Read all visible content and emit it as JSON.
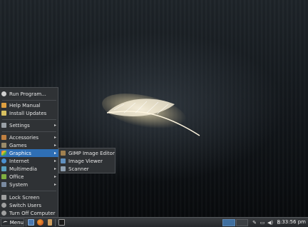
{
  "menu": {
    "items": [
      {
        "name": "run-program",
        "label": "Run Program...",
        "icon": "run-icon",
        "color": "#cfcfcf",
        "arrow": false
      },
      {
        "name": "help-manual",
        "label": "Help Manual",
        "icon": "help-icon",
        "color": "#e0a040",
        "arrow": false
      },
      {
        "name": "install-updates",
        "label": "Install Updates",
        "icon": "update-icon",
        "color": "#d8c060",
        "arrow": false
      },
      {
        "name": "settings",
        "label": "Settings",
        "icon": "settings-icon",
        "color": "#9aa0a6",
        "arrow": true
      },
      {
        "name": "accessories",
        "label": "Accessories",
        "icon": "accessories-icon",
        "color": "#c08040",
        "arrow": true
      },
      {
        "name": "games",
        "label": "Games",
        "icon": "games-icon",
        "color": "#9a8b6a",
        "arrow": true
      },
      {
        "name": "graphics",
        "label": "Graphics",
        "icon": "graphics-icon",
        "color": "#d04080",
        "arrow": true
      },
      {
        "name": "internet",
        "label": "Internet",
        "icon": "internet-icon",
        "color": "#4a90d0",
        "arrow": true
      },
      {
        "name": "multimedia",
        "label": "Multimedia",
        "icon": "multimedia-icon",
        "color": "#5aa0c0",
        "arrow": true
      },
      {
        "name": "office",
        "label": "Office",
        "icon": "office-icon",
        "color": "#80b040",
        "arrow": true
      },
      {
        "name": "system",
        "label": "System",
        "icon": "system-icon",
        "color": "#7a8aa0",
        "arrow": true
      },
      {
        "name": "lock-screen",
        "label": "Lock Screen",
        "icon": "lock-icon",
        "color": "#a0a0a0",
        "arrow": false
      },
      {
        "name": "switch-users",
        "label": "Switch Users",
        "icon": "users-icon",
        "color": "#a0a0a0",
        "arrow": false
      },
      {
        "name": "turn-off-computer",
        "label": "Turn Off Computer",
        "icon": "power-icon",
        "color": "#a0a0a0",
        "arrow": false
      }
    ],
    "active_item": "Graphics",
    "arrow_glyph": "▸"
  },
  "submenu": {
    "items": [
      {
        "label": "GIMP Image Editor",
        "icon": "gimp-icon",
        "color": "#a08050"
      },
      {
        "label": "Image Viewer",
        "icon": "image-viewer-icon",
        "color": "#6090c0"
      },
      {
        "label": "Scanner",
        "icon": "scanner-icon",
        "color": "#90a0b0"
      }
    ]
  },
  "taskbar": {
    "menu_label": "Menu",
    "clock": "8:33:56 pm",
    "launchers": [
      "file-manager-icon",
      "firefox-icon",
      "text-editor-icon",
      "terminal-icon"
    ],
    "tray": [
      "network-icon",
      "battery-icon",
      "volume-icon",
      "notification-icon"
    ]
  },
  "colors": {
    "accent": "#2f6fb5",
    "menu_bg": "#2f3235",
    "taskbar_bg": "#2b2e31"
  }
}
